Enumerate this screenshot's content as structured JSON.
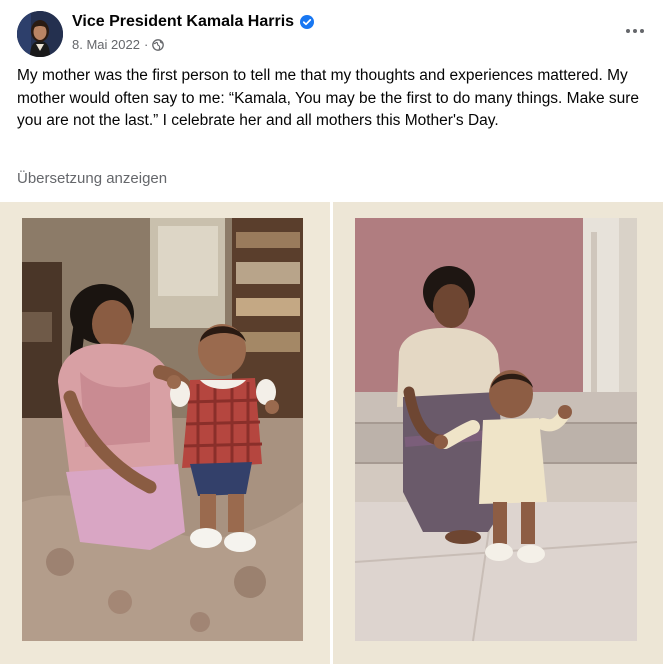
{
  "post": {
    "author": "Vice President Kamala Harris",
    "date": "8. Mai 2022",
    "separator": "·",
    "text": "My mother was the first person to tell me that my thoughts and experiences mattered. My mother would often say to me: “Kamala, You may be the first to do many things. Make sure you are not the last.” I celebrate her and all mothers this Mother's Day.",
    "translate_label": "Übersetzung anzeigen"
  },
  "icons": {
    "verified": "verified-badge-icon",
    "audience": "globe-icon",
    "more": "more-options-icon"
  },
  "colors": {
    "verified_blue": "#1877f2",
    "secondary_text": "#65676b",
    "primary_text": "#050505"
  },
  "photos": [
    {
      "name": "mother-and-baby-indoor-photo"
    },
    {
      "name": "mother-and-baby-outdoor-photo"
    }
  ]
}
